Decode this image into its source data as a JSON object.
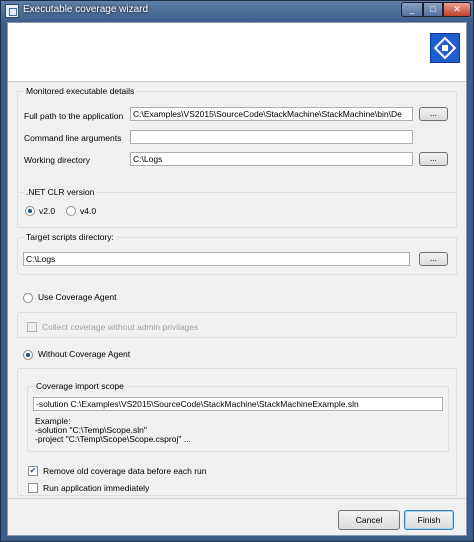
{
  "window": {
    "title": "Executable coverage wizard",
    "minimize": "_",
    "maximize": "□",
    "close": "✕"
  },
  "monitored": {
    "legend": "Monitored executable details",
    "full_path_label": "Full path to the application",
    "full_path_value": "C:\\Examples\\VS2015\\SourceCode\\StackMachine\\StackMachine\\bin\\De",
    "cmd_label": "Command line arguments",
    "cmd_value": "",
    "workdir_label": "Working directory",
    "workdir_value": "C:\\Logs",
    "browse_label": "..."
  },
  "clr": {
    "legend": ".NET CLR version",
    "v2_label": "v2.0",
    "v4_label": "v4.0",
    "selected": "v2.0"
  },
  "target": {
    "legend": "Target scripts directory:",
    "value": "C:\\Logs",
    "browse_label": "..."
  },
  "agent": {
    "use_label": "Use Coverage Agent",
    "collect_label": "Collect coverage without admin privilages",
    "without_label": "Without Coverage Agent",
    "selected": "without"
  },
  "import": {
    "legend": "Coverage import scope",
    "value": "-solution C:\\Examples\\VS2015\\SourceCode\\StackMachine\\StackMachineExample.sln",
    "example_title": "Example:",
    "example_line1": "-solution \"C:\\Temp\\Scope.sln\"",
    "example_line2": "-project \"C:\\Temp\\Scope\\Scope.csproj\" ..."
  },
  "options": {
    "remove_label": "Remove old coverage data before each run",
    "remove_checked": true,
    "run_label": "Run application immediately",
    "run_checked": false,
    "check_glyph": "✔"
  },
  "footer": {
    "cancel_label": "Cancel",
    "finish_label": "Finish"
  }
}
